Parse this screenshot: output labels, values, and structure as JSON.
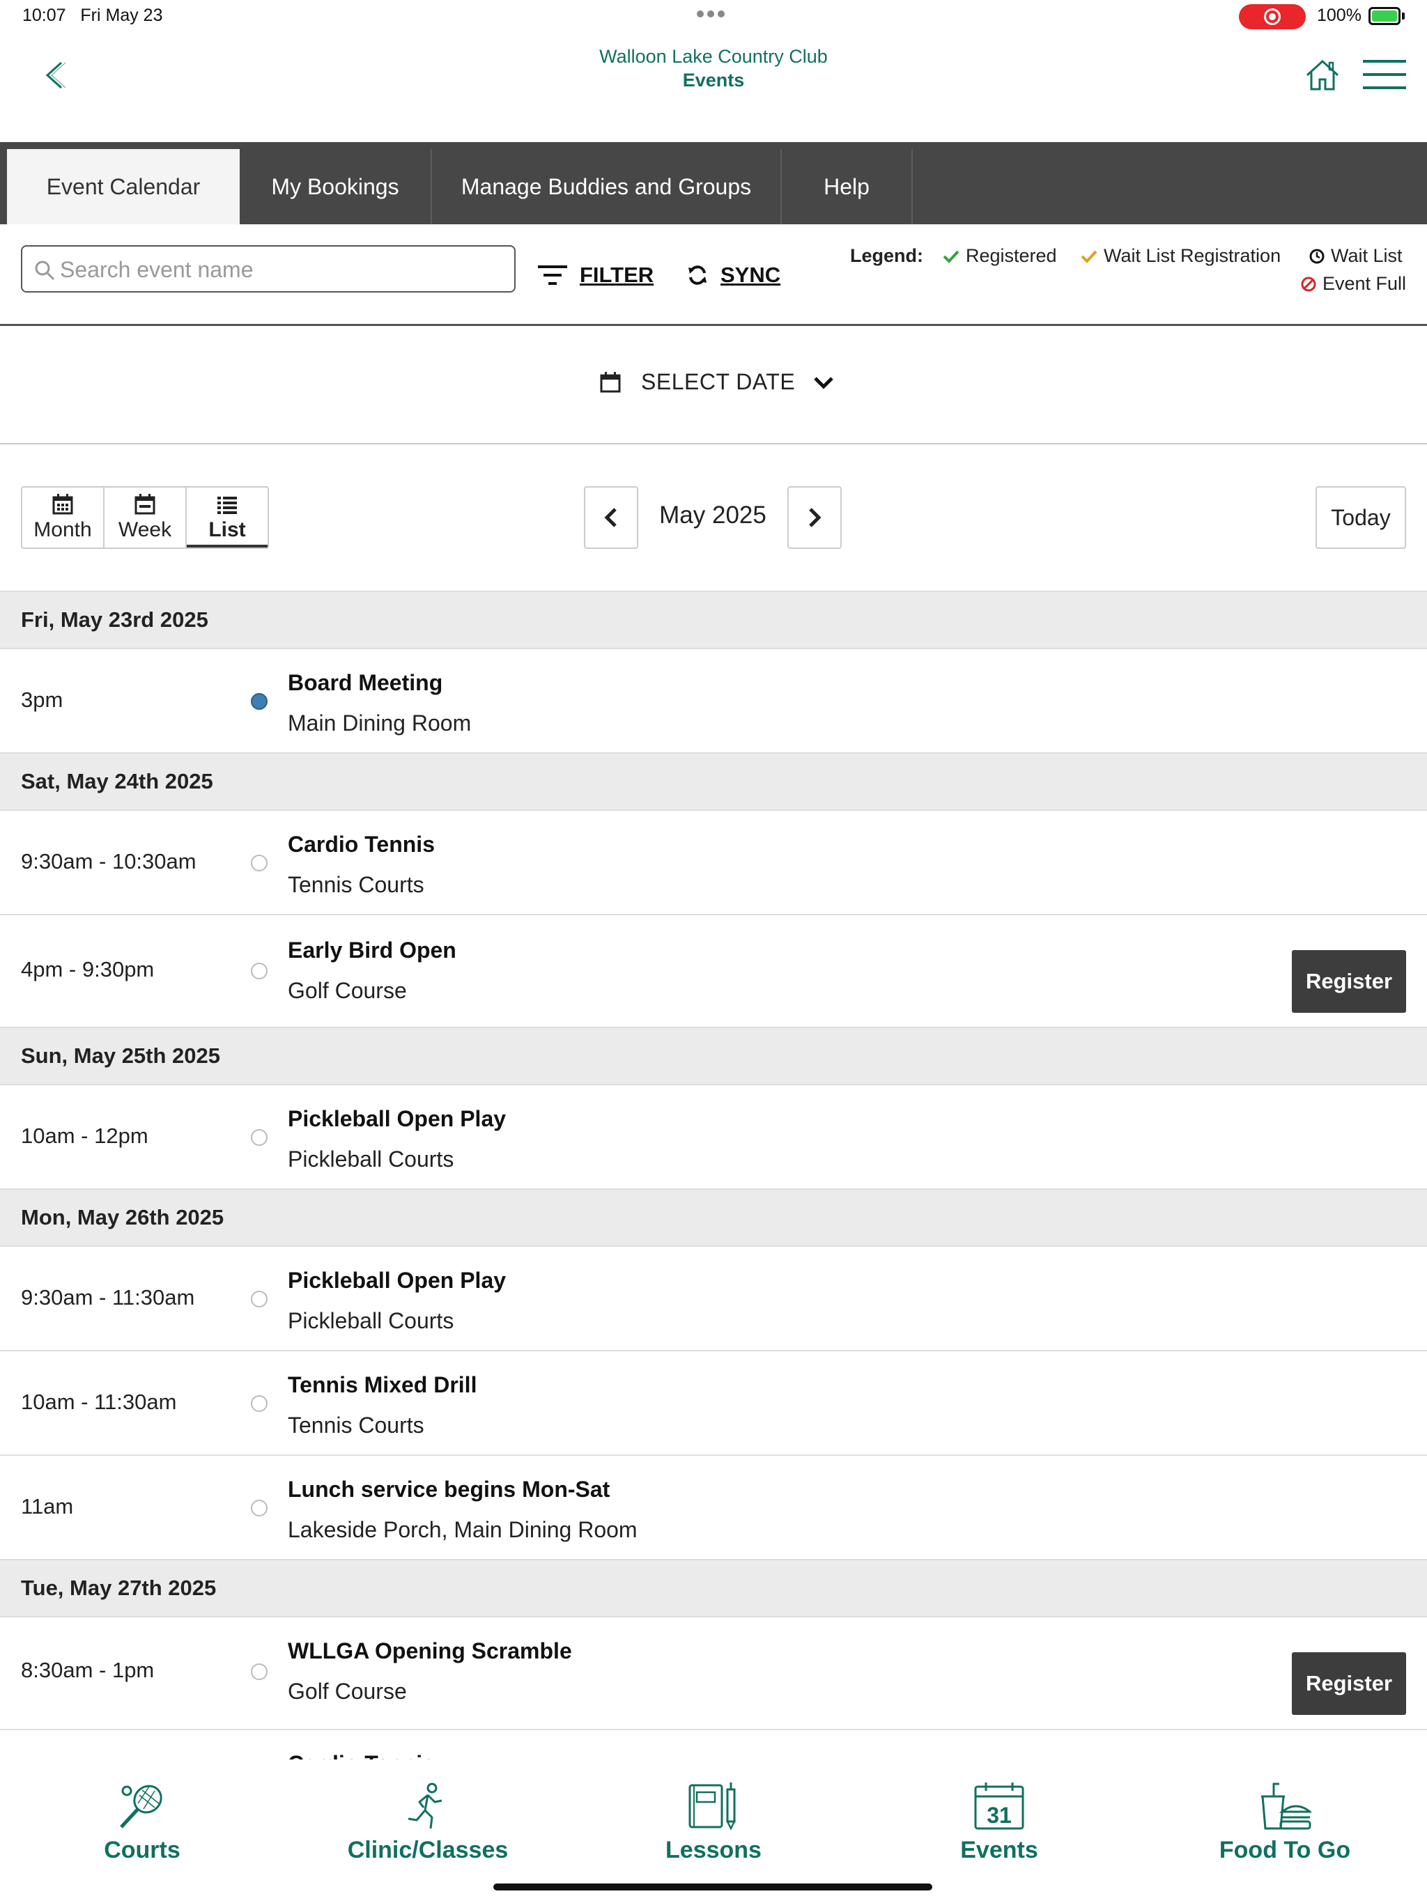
{
  "status_bar": {
    "time": "10:07",
    "date": "Fri May 23",
    "battery": "100%"
  },
  "header": {
    "club_name": "Walloon Lake Country Club",
    "section": "Events"
  },
  "tabs": [
    {
      "label": "Event Calendar",
      "active": true
    },
    {
      "label": "My Bookings",
      "active": false
    },
    {
      "label": "Manage Buddies and Groups",
      "active": false
    },
    {
      "label": "Help",
      "active": false
    }
  ],
  "search": {
    "placeholder": "Search event name",
    "value": ""
  },
  "toolbar": {
    "filter_label": "FILTER",
    "sync_label": "SYNC"
  },
  "legend": {
    "title": "Legend:",
    "registered": "Registered",
    "wait_list_registration": "Wait List Registration",
    "wait_list": "Wait List",
    "event_full": "Event Full",
    "colors": {
      "registered": "#2ea83a",
      "wait_list_registration": "#e0a01c",
      "event_full": "#d8232a"
    }
  },
  "date_select": {
    "label": "SELECT DATE"
  },
  "view": {
    "modes": [
      "Month",
      "Week",
      "List"
    ],
    "active": "List",
    "month_label": "May 2025",
    "today_label": "Today"
  },
  "days": [
    {
      "date": "Fri, May 23rd 2025",
      "events": [
        {
          "time": "3pm",
          "name": "Board Meeting",
          "location": "Main Dining Room",
          "filled": true,
          "register": ""
        }
      ]
    },
    {
      "date": "Sat, May 24th 2025",
      "events": [
        {
          "time": "9:30am - 10:30am",
          "name": "Cardio Tennis",
          "location": "Tennis Courts",
          "filled": false,
          "register": ""
        },
        {
          "time": "4pm - 9:30pm",
          "name": "Early Bird Open",
          "location": "Golf Course",
          "filled": false,
          "register": "Register"
        }
      ]
    },
    {
      "date": "Sun, May 25th 2025",
      "events": [
        {
          "time": "10am - 12pm",
          "name": "Pickleball Open Play",
          "location": "Pickleball Courts",
          "filled": false,
          "register": ""
        }
      ]
    },
    {
      "date": "Mon, May 26th 2025",
      "events": [
        {
          "time": "9:30am - 11:30am",
          "name": "Pickleball Open Play",
          "location": "Pickleball Courts",
          "filled": false,
          "register": ""
        },
        {
          "time": "10am - 11:30am",
          "name": "Tennis Mixed Drill",
          "location": "Tennis Courts",
          "filled": false,
          "register": ""
        },
        {
          "time": "11am",
          "name": "Lunch service begins Mon-Sat",
          "location": "Lakeside Porch, Main Dining Room",
          "filled": false,
          "register": ""
        }
      ]
    },
    {
      "date": "Tue, May 27th 2025",
      "events": [
        {
          "time": "8:30am - 1pm",
          "name": "WLLGA Opening Scramble",
          "location": "Golf Course",
          "filled": false,
          "register": "Register"
        },
        {
          "time": "",
          "name": "Cardio Tennis",
          "location": "",
          "filled": false,
          "register": ""
        }
      ]
    }
  ],
  "bottom_nav": [
    {
      "label": "Courts",
      "icon": "tennis-racket-icon"
    },
    {
      "label": "Clinic/Classes",
      "icon": "running-person-icon"
    },
    {
      "label": "Lessons",
      "icon": "notebook-pencil-icon"
    },
    {
      "label": "Events",
      "icon": "calendar-icon",
      "day": "31"
    },
    {
      "label": "Food To Go",
      "icon": "takeout-burger-icon"
    }
  ],
  "colors": {
    "brand": "#10705f",
    "tabbar": "#474747",
    "register_button": "#3d3d3d"
  }
}
